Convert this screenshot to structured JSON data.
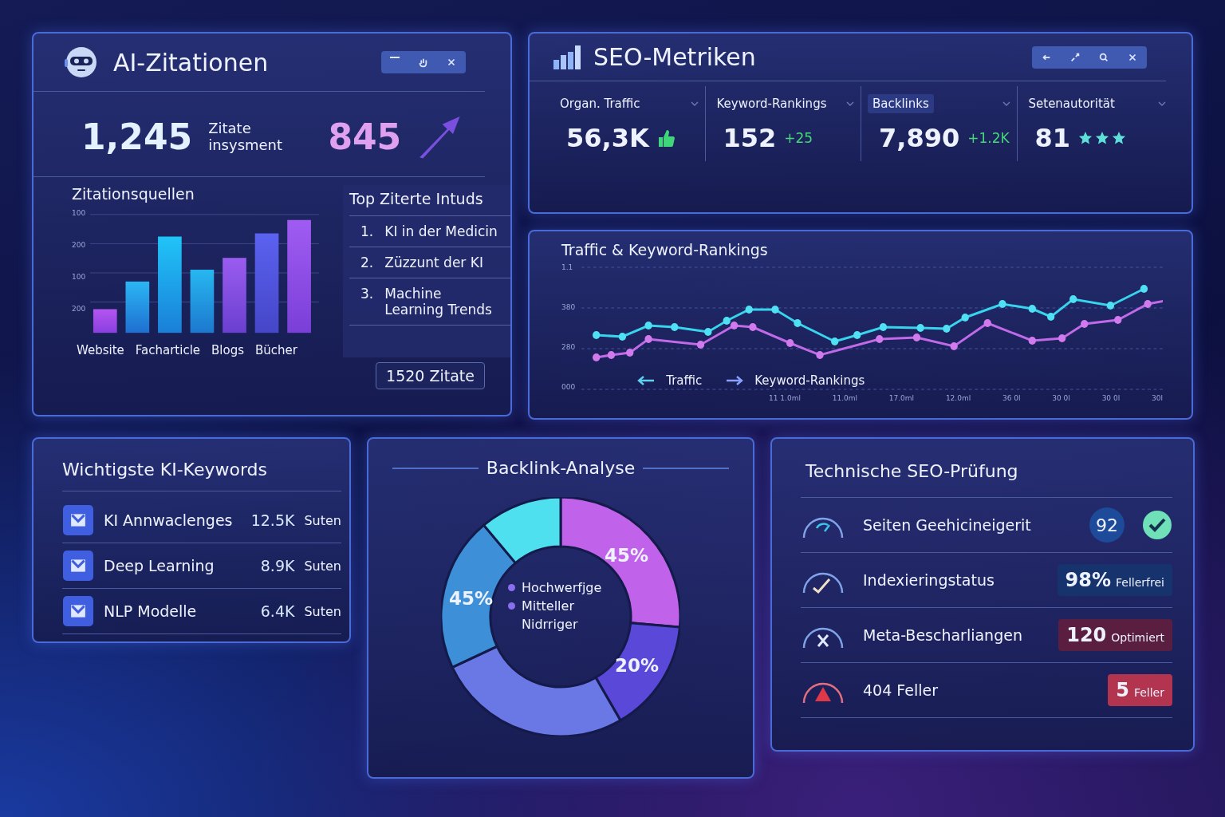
{
  "citations": {
    "title": "AI-Zitationen",
    "window_controls": [
      {
        "kind": "minimize"
      },
      {
        "kind": "hand"
      },
      {
        "kind": "close"
      }
    ],
    "total": "1,245",
    "total_label": "Zitate insysment",
    "highlight": "845",
    "sources": {
      "title": "Zitationsquellen",
      "y_axis_labels": [
        "100",
        "200",
        "100",
        "200"
      ],
      "categories": [
        "Website",
        "Facharticle",
        "Blogs",
        "Bücher"
      ]
    },
    "top_list": {
      "title": "Top Ziterte Intuds",
      "items": [
        {
          "number": "1.",
          "text": "KI in der Medicin"
        },
        {
          "number": "2.",
          "text": "Züzzunt der KI"
        },
        {
          "number": "3.",
          "text": "Machine Learning Trends"
        }
      ]
    },
    "footer": "1520 Zitate"
  },
  "seo": {
    "title": "SEO-Metriken",
    "window_controls": [
      {
        "kind": "back"
      },
      {
        "kind": "expand"
      },
      {
        "kind": "search"
      },
      {
        "kind": "close"
      }
    ],
    "metrics": [
      {
        "label": "Organ. Traffic",
        "value": "56,3K",
        "kind": "icon",
        "selected": false
      },
      {
        "label": "Keyword-Rankings",
        "value": "152",
        "kind": "delta",
        "delta": "+25",
        "selected": false
      },
      {
        "label": "Backlinks",
        "value": "7,890",
        "kind": "delta",
        "delta": "+1.2K",
        "selected": true
      },
      {
        "label": "Setenautorität",
        "value": "81",
        "kind": "stars",
        "stars": 3,
        "selected": false
      }
    ]
  },
  "traffic": {
    "title": "Traffic & Keyword-Rankings",
    "y_axis_labels": [
      "1.1",
      "380",
      "280",
      "000"
    ],
    "x_axis_labels": [
      "11 1.0ml",
      "11.0ml",
      "17.0ml",
      "12.0ml",
      "36 0l",
      "30 0l",
      "30 0l",
      "30l"
    ],
    "legend": [
      {
        "label": "Traffic",
        "color": "#5fd0f0"
      },
      {
        "label": "Keyword-Rankings",
        "color": "#8aa0ff"
      }
    ]
  },
  "keywords": {
    "title": "Wichtigste KI-Keywords",
    "items": [
      {
        "name": "KI Annwaclenges",
        "value": "12.5K",
        "unit": "Suten"
      },
      {
        "name": "Deep Learning",
        "value": "8.9K",
        "unit": "Suten"
      },
      {
        "name": "NLP Modelle",
        "value": "6.4K",
        "unit": "Suten"
      }
    ]
  },
  "backlinks": {
    "title": "Backlink-Analyse",
    "slice_labels": [
      "45%",
      "45%",
      "20%"
    ],
    "legend": [
      "Hochwerfjge",
      "Mitteller",
      "Nidrriger"
    ]
  },
  "audit": {
    "title": "Technische SEO-Prüfung",
    "rows": [
      {
        "label": "Seiten Geehicineigerit",
        "kind": "score",
        "value": "92"
      },
      {
        "label": "Indexieringstatus",
        "kind": "badge",
        "value": "98%",
        "unit": "Fellerfrei",
        "color": "#16336e"
      },
      {
        "label": "Meta-Bescharliangen",
        "kind": "badge",
        "value": "120",
        "unit": "Optimiert",
        "color": "#5a1e40"
      },
      {
        "label": "404 Feller",
        "kind": "badge",
        "value": "5",
        "unit": "Feller",
        "color": "#b3344f"
      }
    ]
  }
}
